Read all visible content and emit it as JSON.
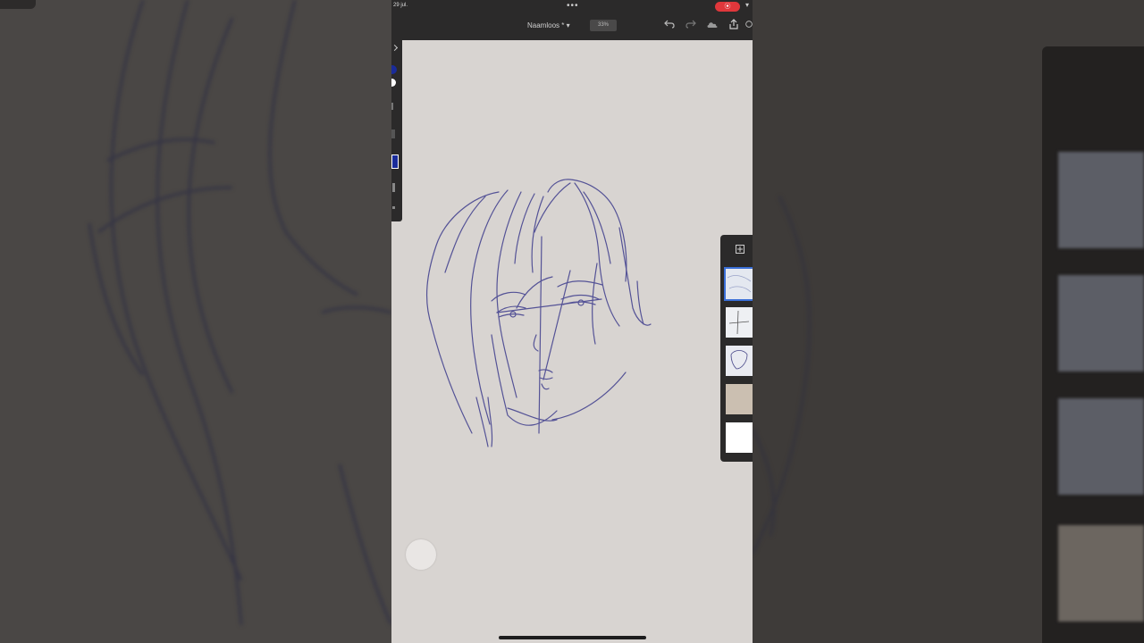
{
  "status_bar": {
    "date": "29 jul.",
    "more_dots": "•••",
    "record_indicator": "⦿"
  },
  "toolbar": {
    "document_title": "Naamloos *",
    "zoom_level": "33%",
    "icons": [
      "undo-icon",
      "redo-icon",
      "cloud-icon",
      "share-icon",
      "more-icon"
    ]
  },
  "layers": {
    "add_icon": "plus-square-icon",
    "count": 5,
    "selected_index": 0
  },
  "colors": {
    "ui_dark": "#2b2a2a",
    "canvas": "#d8d4d1",
    "sketch_stroke": "#3d3c8c",
    "record_red": "#e0373b",
    "selection_blue": "#3a6fd8"
  }
}
